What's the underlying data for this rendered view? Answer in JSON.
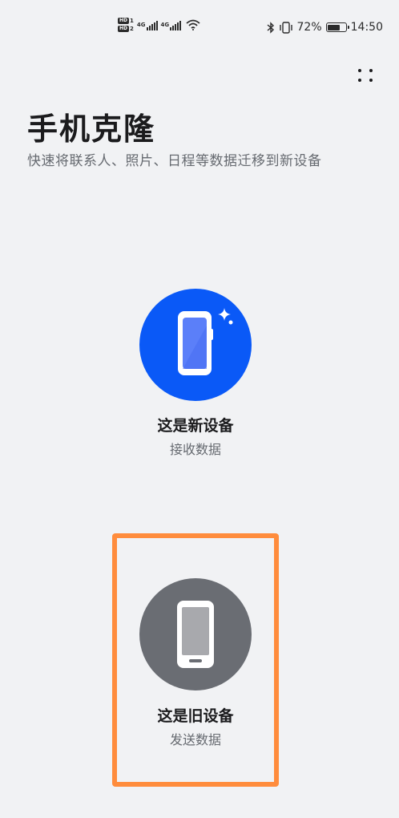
{
  "status_bar": {
    "hd1": "HD",
    "hd1_num": "1",
    "hd2": "HD",
    "hd2_num": "2",
    "net1": "4G",
    "net2": "4G",
    "battery_percent": "72%",
    "battery_level": 0.72,
    "time": "14:50",
    "icons": [
      "hd-icon",
      "signal-icon",
      "wifi-icon",
      "bluetooth-icon",
      "vibrate-icon",
      "battery-icon"
    ]
  },
  "header": {
    "title": "手机克隆",
    "subtitle": "快速将联系人、照片、日程等数据迁移到新设备",
    "more_icon": "more-icon"
  },
  "options": {
    "new_device": {
      "title": "这是新设备",
      "subtitle": "接收数据",
      "icon": "new-phone-icon",
      "circle_color": "#0a59f7"
    },
    "old_device": {
      "title": "这是旧设备",
      "subtitle": "发送数据",
      "icon": "old-phone-icon",
      "circle_color": "#6a6d73",
      "highlight_color": "#ff8c3c"
    }
  }
}
